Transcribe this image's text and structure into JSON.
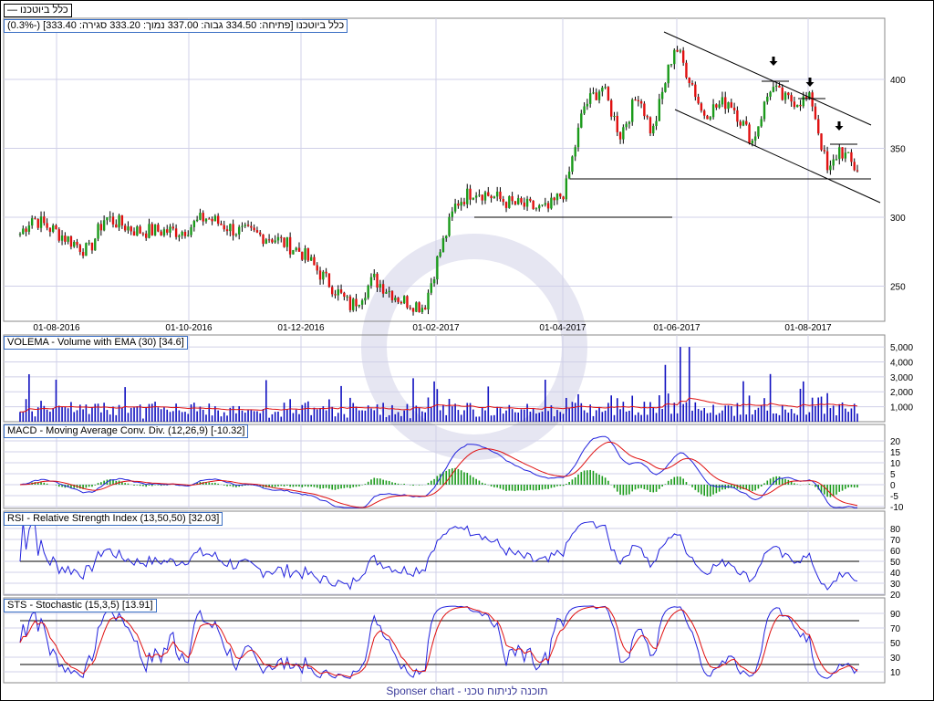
{
  "series_legend": "כלל ביוטכנו —",
  "quote": {
    "text": "כלל ביוטכנו [פתיחה: 334.50  גבוה: 337.00  נמוך: 333.20  סגירה: 333.40] (-0.3%)"
  },
  "footer": "תוכנה לניתוח טכני - Sponser chart",
  "colors": {
    "up": "#1a9a1a",
    "down": "#e01010",
    "line": "#2222dd",
    "signal": "#e01010",
    "grid": "#d0d0e8"
  },
  "chart_data": [
    {
      "type": "candlestick",
      "title": "כלל ביוטכנו",
      "x_ticks": [
        "01-08-2016",
        "01-10-2016",
        "01-12-2016",
        "01-02-2017",
        "01-04-2017",
        "01-06-2017",
        "01-08-2017"
      ],
      "y_ticks": [
        250,
        300,
        350,
        400
      ],
      "ylim": [
        230,
        430
      ],
      "close_keypoints": [
        288,
        300,
        290,
        275,
        300,
        290,
        290,
        300,
        290,
        285,
        275,
        260,
        235,
        255,
        240,
        235,
        270,
        310,
        320,
        310,
        305,
        320,
        380,
        395,
        360,
        390,
        360,
        400,
        425,
        395,
        375,
        385,
        355,
        395,
        385,
        385,
        330,
        350,
        333.4
      ],
      "annotations": {
        "support_lines": [
          300,
          328
        ],
        "trend_channel": "descending",
        "arrows": 3
      }
    },
    {
      "type": "bar",
      "title": "VOLEMA - Volume with EMA (30) [34.6]",
      "y_ticks": [
        "1,000",
        "2,000",
        "3,000",
        "4,000",
        "5,000"
      ],
      "ylim": [
        0,
        5000
      ]
    },
    {
      "type": "line",
      "title": "MACD - Moving Average Conv. Div. (12,26,9) [-10.32]",
      "y_ticks": [
        -10,
        -5,
        0,
        5,
        10,
        15,
        20
      ],
      "ylim": [
        -11,
        24
      ]
    },
    {
      "type": "line",
      "title": "RSI - Relative Strength Index (13,50,50) [32.03]",
      "y_ticks": [
        20,
        30,
        40,
        50,
        60,
        70,
        80
      ],
      "ylim": [
        10,
        88
      ],
      "ref_line": 50
    },
    {
      "type": "line",
      "title": "STS - Stochastic (15,3,5) [13.91]",
      "y_ticks": [
        10,
        30,
        50,
        70,
        90
      ],
      "ylim": [
        0,
        100
      ],
      "ref_lines": [
        20,
        80
      ]
    }
  ]
}
